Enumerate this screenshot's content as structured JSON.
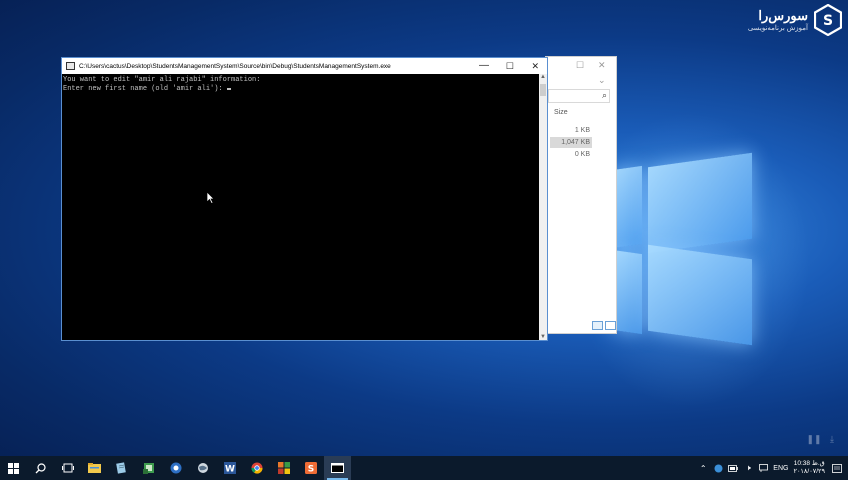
{
  "brand": {
    "name": "سورس‌را",
    "tagline": "آموزش برنامه‌نویسی"
  },
  "console": {
    "title": "C:\\Users\\cactus\\Desktop\\StudentsManagementSystem\\Source\\bin\\Debug\\StudentsManagementSystem.exe",
    "lines": [
      "You want to edit \"amir ali rajabi\" information:",
      "",
      "Enter new first name (old 'amir ali'): "
    ],
    "controls": {
      "minimize": "—",
      "maximize": "☐",
      "close": "✕"
    }
  },
  "explorer": {
    "size_header": "Size",
    "sizes": [
      "1 KB",
      "1,047 KB",
      "0 KB"
    ],
    "selected_index": 1
  },
  "taskbar": {
    "apps": [
      "start",
      "search",
      "task-view",
      "file-explorer",
      "notepad",
      "excel-like",
      "blue-app",
      "app-globe",
      "word",
      "chrome",
      "office-tiles",
      "sublime",
      "console"
    ],
    "active_app": "console",
    "language": "ENG",
    "time": "10:38 ق.ظ",
    "date": "۲۰۱۸/۰۷/۲۹"
  },
  "colors": {
    "console_bg": "#000000",
    "console_text": "#c0c0c0",
    "taskbar_bg": "#0b1a2c",
    "accent": "#76b9ed"
  }
}
